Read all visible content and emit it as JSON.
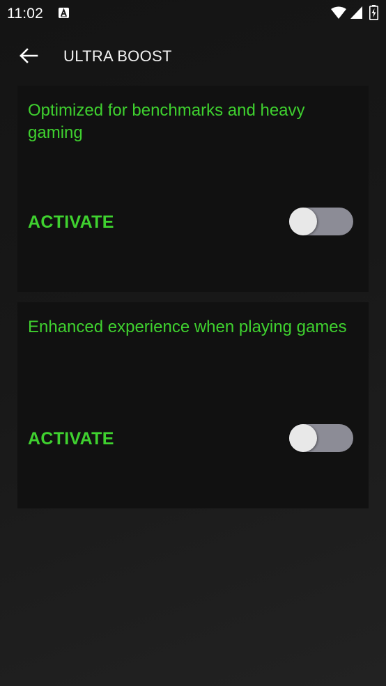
{
  "status_bar": {
    "time": "11:02"
  },
  "icons": {
    "notification": "text-a-notification-icon",
    "wifi": "wifi-icon",
    "signal": "cell-signal-icon",
    "battery": "battery-charging-icon",
    "back": "arrow-left-icon"
  },
  "header": {
    "title": "ULTRA BOOST"
  },
  "modes": [
    {
      "description": "Optimized for benchmarks and heavy gaming",
      "activate_label": "ACTIVATE",
      "enabled": false
    },
    {
      "description": "Enhanced experience when playing games",
      "activate_label": "ACTIVATE",
      "enabled": false
    }
  ],
  "colors": {
    "accent": "#3fd12f",
    "card_background": "#111111",
    "toggle_track": "#8c8c96",
    "toggle_thumb": "#e8e8e8"
  }
}
